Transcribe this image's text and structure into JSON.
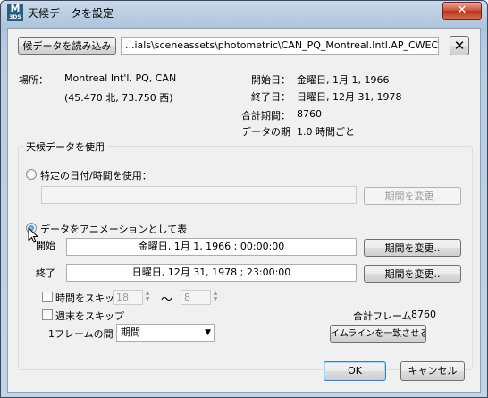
{
  "window": {
    "icon_text": "M",
    "icon_sub": "3DS",
    "title": "天候データを設定",
    "close_glyph": "✕"
  },
  "file": {
    "load_label": "候データを読み込み",
    "path": "...ials\\sceneassets\\photometric\\CAN_PQ_Montreal.Intl.AP_CWEC.epw",
    "clear_glyph": "✕"
  },
  "location": {
    "label": "場所：",
    "name": "Montreal Int'l, PQ, CAN",
    "coords": "(45.470 北, 73.750 西)"
  },
  "period_info": {
    "start_label": "開始日：",
    "start_value": "金曜日, 1月 1, 1966",
    "end_label": "終了日：",
    "end_value": "日曜日, 12月 31, 1978",
    "total_label": "合計期間：",
    "total_value": "8760",
    "data_period_label": "データの期",
    "data_period_value": "1.0 時間ごと"
  },
  "usage": {
    "group_title": "天候データを使用",
    "specific_label": "特定の日付/時間を使用：",
    "specific_value": "",
    "specific_change": "期間を変更..",
    "animation_label": "データをアニメーションとして表",
    "start_label": "開始",
    "start_value": "金曜日, 1月 1, 1966 ; 00:00:00",
    "start_change": "期間を変更..",
    "end_label": "終了",
    "end_value": "日曜日, 12月 31, 1978 ; 23:00:00",
    "end_change": "期間を変更..",
    "skip_time_label": "時間をスキッ",
    "skip_from": "18",
    "tilde": "〜",
    "skip_to": "8",
    "skip_weekend_label": "週末をスキップ",
    "total_frames_label": "合計フレーム",
    "total_frames_value": "8760",
    "frame_interval_label": "1フレームの間",
    "frame_interval_value": "期間",
    "match_timeline": "イムラインを一致させる"
  },
  "buttons": {
    "ok": "OK",
    "cancel": "キャンセル"
  }
}
